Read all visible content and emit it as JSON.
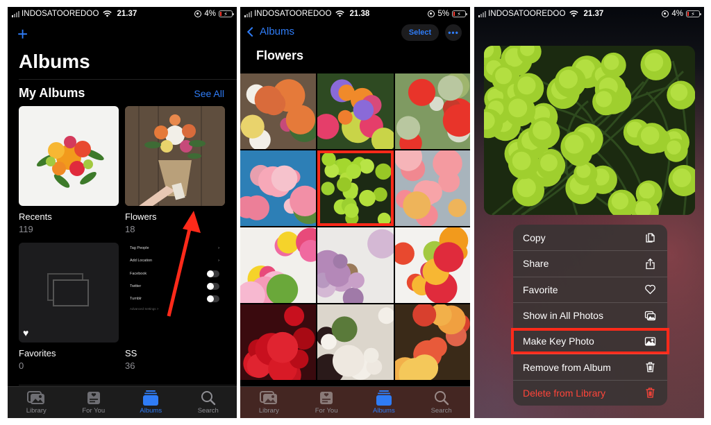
{
  "status_bars": [
    {
      "carrier": "INDOSATOOREDOO",
      "time": "21.37",
      "battery": "4%"
    },
    {
      "carrier": "INDOSATOOREDOO",
      "time": "21.38",
      "battery": "5%"
    },
    {
      "carrier": "INDOSATOOREDOO",
      "time": "21.37",
      "battery": "4%"
    }
  ],
  "albums_screen": {
    "add_icon": "plus-icon",
    "title": "Albums",
    "section_title": "My Albums",
    "see_all": "See All",
    "albums": [
      {
        "name": "Recents",
        "count": "119"
      },
      {
        "name": "Flowers",
        "count": "18"
      },
      {
        "name": "Favorites",
        "count": "0"
      },
      {
        "name": "SS",
        "count": "36"
      }
    ],
    "ss_thumbnail_rows": [
      {
        "label": "Tag People",
        "control": "chevron"
      },
      {
        "label": "Add Location",
        "control": "chevron"
      },
      {
        "label": "Facebook",
        "control": "toggle"
      },
      {
        "label": "Twitter",
        "control": "toggle"
      },
      {
        "label": "Tumblr",
        "control": "toggle"
      },
      {
        "label": "Advanced Settings >",
        "control": "none"
      }
    ]
  },
  "tabbar": [
    {
      "label": "Library",
      "icon": "photo-library-icon",
      "active": false
    },
    {
      "label": "For You",
      "icon": "for-you-icon",
      "active": false
    },
    {
      "label": "Albums",
      "icon": "albums-icon",
      "active": true
    },
    {
      "label": "Search",
      "icon": "search-icon",
      "active": false
    }
  ],
  "flowers_screen": {
    "back_label": "Albums",
    "select_label": "Select",
    "more_label": "•••",
    "title": "Flowers",
    "photos": [
      {
        "subject": "bouquet in hand",
        "highlighted": false
      },
      {
        "subject": "peony and roses",
        "highlighted": false
      },
      {
        "subject": "red anemone",
        "highlighted": false
      },
      {
        "subject": "pink amaryllis",
        "highlighted": false
      },
      {
        "subject": "green chrysanthemums",
        "highlighted": true
      },
      {
        "subject": "pink peonies",
        "highlighted": false
      },
      {
        "subject": "tulips",
        "highlighted": false
      },
      {
        "subject": "lilac bouquet",
        "highlighted": false
      },
      {
        "subject": "bouquet on white",
        "highlighted": false
      },
      {
        "subject": "red roses",
        "highlighted": false
      },
      {
        "subject": "white anemones",
        "highlighted": false
      },
      {
        "subject": "red tulips",
        "highlighted": false
      }
    ]
  },
  "context_menu": {
    "items": [
      {
        "label": "Copy",
        "icon": "copy-icon",
        "danger": false,
        "highlighted": false
      },
      {
        "label": "Share",
        "icon": "share-icon",
        "danger": false,
        "highlighted": false
      },
      {
        "label": "Favorite",
        "icon": "heart-icon",
        "danger": false,
        "highlighted": false
      },
      {
        "label": "Show in All Photos",
        "icon": "photos-icon",
        "danger": false,
        "highlighted": false
      },
      {
        "label": "Make Key Photo",
        "icon": "photo-icon",
        "danger": false,
        "highlighted": true
      },
      {
        "label": "Remove from Album",
        "icon": "trash-icon",
        "danger": false,
        "highlighted": false
      },
      {
        "label": "Delete from Library",
        "icon": "trash-icon",
        "danger": true,
        "highlighted": false
      }
    ]
  },
  "colors": {
    "accent": "#2f7cf6",
    "highlight": "#ff2a1a",
    "danger": "#ff453a",
    "background": "#000000"
  }
}
